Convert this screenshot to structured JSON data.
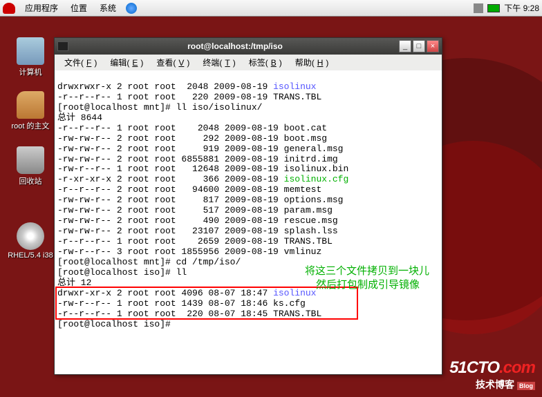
{
  "panel": {
    "apps": "应用程序",
    "places": "位置",
    "system": "系统",
    "time": "下午 9:28"
  },
  "desktop_icons": {
    "computer": "计算机",
    "home": "root 的主文",
    "trash": "回收站",
    "drive": "RHEL/5.4 i38"
  },
  "terminal": {
    "title": "root@localhost:/tmp/iso",
    "menu": {
      "file": "文件(",
      "file_u": "F",
      "file2": ")",
      "edit": "编辑(",
      "edit_u": "E",
      "edit2": ")",
      "view": "查看(",
      "view_u": "V",
      "view2": ")",
      "term": "终端(",
      "term_u": "T",
      "term2": ")",
      "tabs": "标签(",
      "tabs_u": "B",
      "tabs2": ")",
      "help": "帮助(",
      "help_u": "H",
      "help2": ")"
    },
    "lines": {
      "l01a": "drwxrwxr-x 2 root root  2048 2009-08-19 ",
      "l01b": "isolinux",
      "l02": "-r--r--r-- 1 root root   220 2009-08-19 TRANS.TBL",
      "l03": "[root@localhost mnt]# ll iso/isolinux/",
      "l04": "总计 8644",
      "l05": "-r--r--r-- 1 root root    2048 2009-08-19 boot.cat",
      "l06": "-rw-rw-r-- 2 root root     292 2009-08-19 boot.msg",
      "l07": "-rw-rw-r-- 2 root root     919 2009-08-19 general.msg",
      "l08": "-rw-rw-r-- 2 root root 6855881 2009-08-19 initrd.img",
      "l09": "-rw-r--r-- 1 root root   12648 2009-08-19 isolinux.bin",
      "l10a": "-r-xr-xr-x 2 root root     366 2009-08-19 ",
      "l10b": "isolinux.cfg",
      "l11": "-r--r--r-- 2 root root   94600 2009-08-19 memtest",
      "l12": "-rw-rw-r-- 2 root root     817 2009-08-19 options.msg",
      "l13": "-rw-rw-r-- 2 root root     517 2009-08-19 param.msg",
      "l14": "-rw-rw-r-- 2 root root     490 2009-08-19 rescue.msg",
      "l15": "-rw-rw-r-- 2 root root   23107 2009-08-19 splash.lss",
      "l16": "-r--r--r-- 1 root root    2659 2009-08-19 TRANS.TBL",
      "l17": "-rw-r--r-- 3 root root 1855956 2009-08-19 vmlinuz",
      "l18": "[root@localhost mnt]# cd /tmp/iso/",
      "l19": "[root@localhost iso]# ll",
      "l20": "总计 12",
      "l21a": "drwxr-xr-x 2 root root 4096 08-07 18:47 ",
      "l21b": "isolinux",
      "l22": "-rw-r--r-- 1 root root 1439 08-07 18:46 ks.cfg",
      "l23": "-r--r--r-- 1 root root  220 08-07 18:45 TRANS.TBL",
      "l24": "[root@localhost iso]# "
    }
  },
  "annotations": {
    "a1": "将这三个文件拷贝到一块儿",
    "a2": "然后打包制成引导镜像"
  },
  "watermark": {
    "brand": "51CTO",
    "dot": ".com",
    "sub": "技术博客",
    "blog": "Blog"
  }
}
